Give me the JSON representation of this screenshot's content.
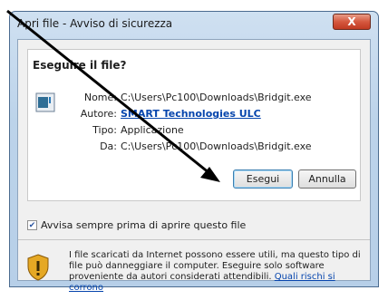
{
  "window": {
    "title": "Apri file - Avviso di sicurezza",
    "close_glyph": "X"
  },
  "prompt": {
    "heading": "Eseguire il file?"
  },
  "file": {
    "fields": [
      {
        "label": "Nome:",
        "value": "C:\\Users\\Pc100\\Downloads\\Bridgit.exe"
      },
      {
        "label": "Autore:",
        "value": "SMART Technologies ULC"
      },
      {
        "label": "Tipo:",
        "value": "Applicazione"
      },
      {
        "label": "Da:",
        "value": "C:\\Users\\Pc100\\Downloads\\Bridgit.exe"
      }
    ]
  },
  "buttons": {
    "run": "Esegui",
    "cancel": "Annulla"
  },
  "checkbox": {
    "label": "Avvisa sempre prima di aprire questo file",
    "checked": true
  },
  "warning": {
    "text": "I file scaricati da Internet possono essere utili, ma questo tipo di file può danneggiare il computer. Eseguire solo software proveniente da autori considerati attendibili.",
    "link": "Quali rischi si corrono"
  },
  "icons": {
    "close": "close-icon",
    "file": "file-icon",
    "warning": "shield-warning-icon",
    "annotation": "arrow-annotation-icon"
  },
  "colors": {
    "link": "#0645ad",
    "title_bar": "#bcd3ea",
    "close_button": "#d5583f"
  }
}
